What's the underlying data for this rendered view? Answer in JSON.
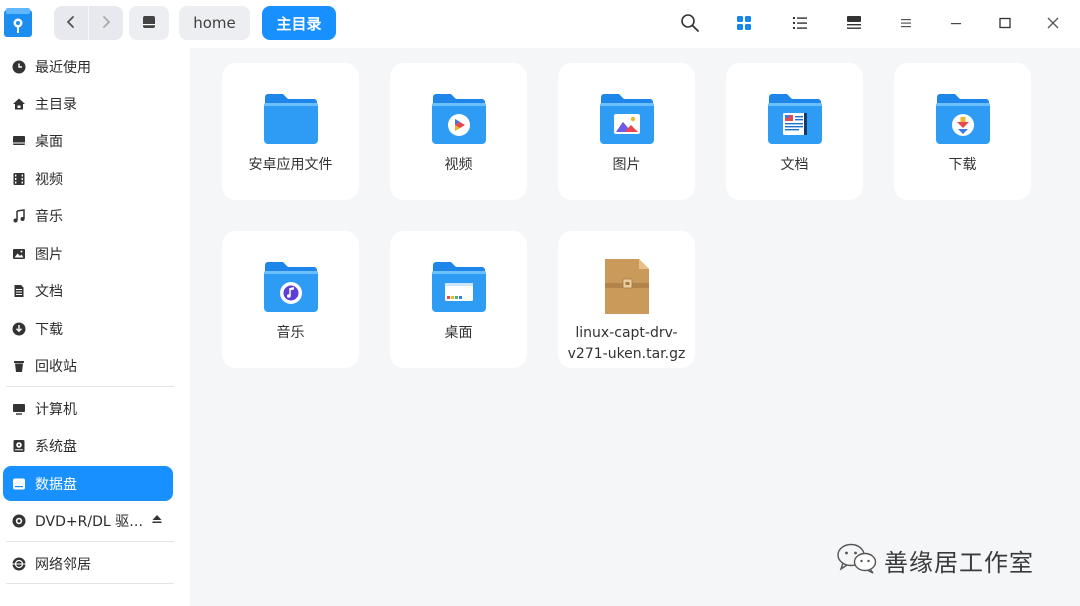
{
  "titlebar": {
    "app_icon": "file-manager-icon",
    "back_icon": "chevron-left-icon",
    "forward_icon": "chevron-right-icon",
    "breadcrumb": {
      "root_icon": "drive-icon",
      "items": [
        "home",
        "主目录"
      ]
    },
    "tools": [
      "search-icon",
      "grid-view-icon",
      "list-view-icon",
      "detail-view-icon",
      "menu-icon",
      "minimize-icon",
      "maximize-icon",
      "close-icon"
    ]
  },
  "sidebar": {
    "items": [
      {
        "label": "最近使用",
        "icon": "clock-icon"
      },
      {
        "label": "主目录",
        "icon": "home-icon"
      },
      {
        "label": "桌面",
        "icon": "desktop-icon"
      },
      {
        "label": "视频",
        "icon": "video-icon"
      },
      {
        "label": "音乐",
        "icon": "music-icon"
      },
      {
        "label": "图片",
        "icon": "picture-icon"
      },
      {
        "label": "文档",
        "icon": "document-icon"
      },
      {
        "label": "下载",
        "icon": "download-icon"
      },
      {
        "label": "回收站",
        "icon": "trash-icon"
      },
      {
        "label": "计算机",
        "icon": "computer-icon"
      },
      {
        "label": "系统盘",
        "icon": "system-disk-icon"
      },
      {
        "label": "数据盘",
        "icon": "data-disk-icon",
        "active": true
      },
      {
        "label": "DVD+R/DL 驱…",
        "icon": "disc-icon"
      },
      {
        "label": "网络邻居",
        "icon": "network-icon"
      }
    ]
  },
  "files": [
    {
      "name": "安卓应用文件",
      "type": "folder"
    },
    {
      "name": "视频",
      "type": "folder-video"
    },
    {
      "name": "图片",
      "type": "folder-picture"
    },
    {
      "name": "文档",
      "type": "folder-document"
    },
    {
      "name": "下载",
      "type": "folder-download"
    },
    {
      "name": "音乐",
      "type": "folder-music"
    },
    {
      "name": "桌面",
      "type": "folder-desktop"
    },
    {
      "name_line1": "linux-capt-drv-",
      "name_line2": "v271-uken.tar.gz",
      "type": "archive"
    }
  ],
  "watermark": {
    "text": "善缘居工作室",
    "icon": "wechat-icon"
  },
  "colors": {
    "accent": "#1890ff",
    "folder": "#2e9cf5",
    "archive": "#c99a5a"
  }
}
